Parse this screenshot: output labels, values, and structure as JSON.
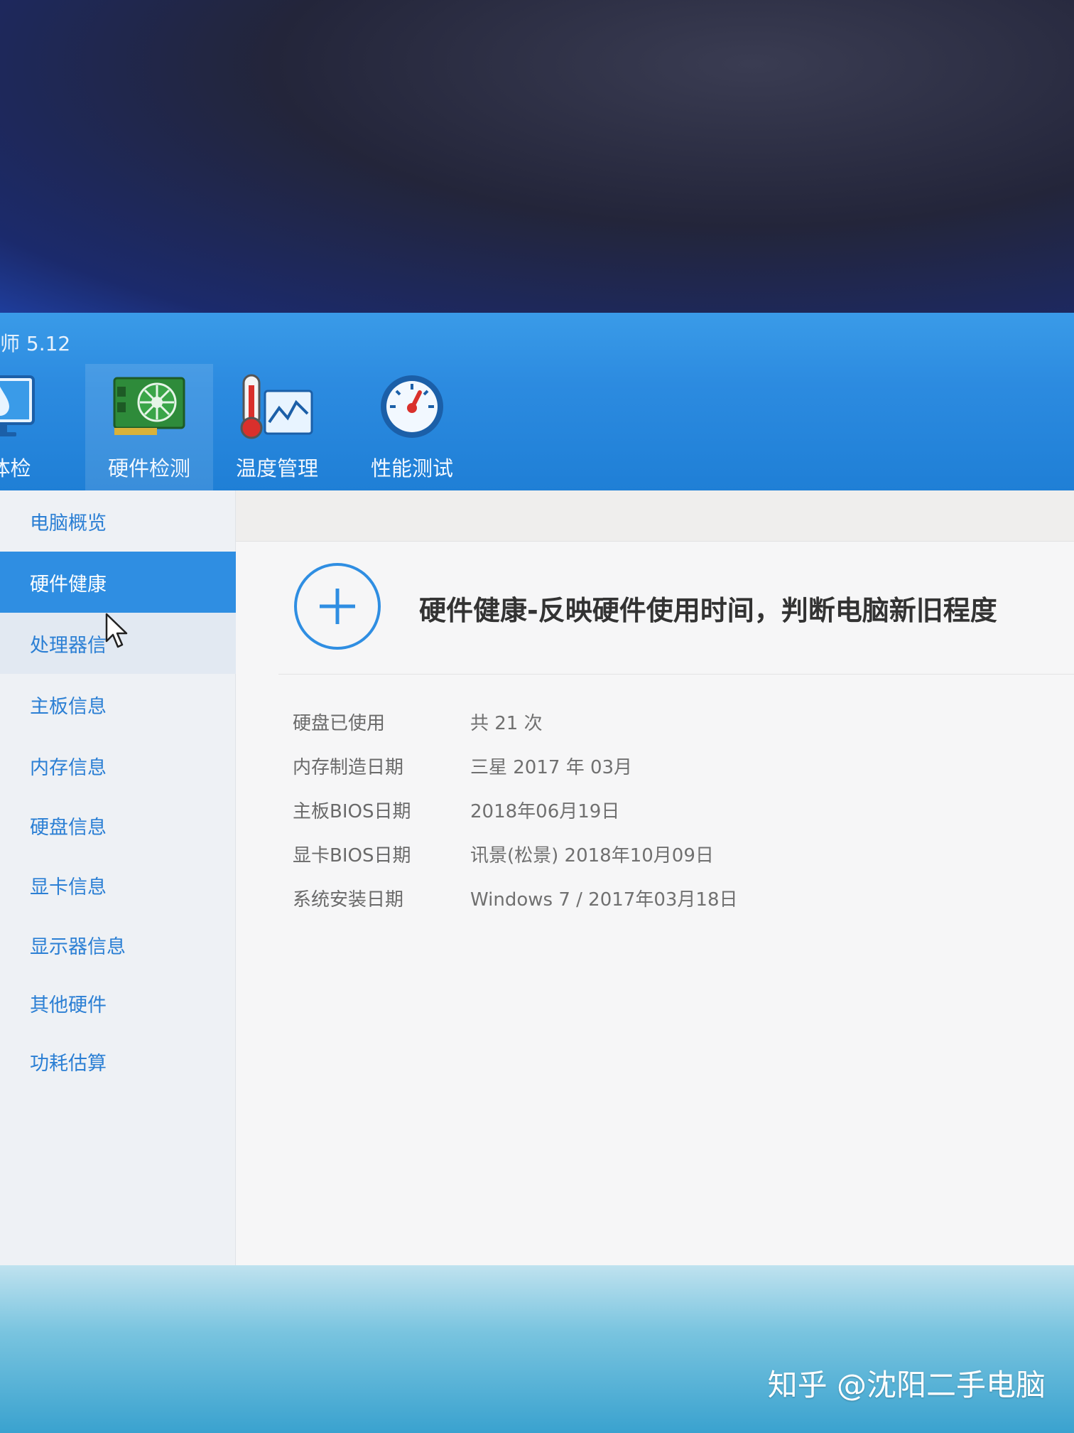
{
  "app": {
    "title": "师 5.12"
  },
  "tabs": [
    {
      "label": "件体检",
      "icon": "monitor-drop-icon"
    },
    {
      "label": "硬件检测",
      "icon": "hardware-card-icon"
    },
    {
      "label": "温度管理",
      "icon": "thermometer-chart-icon"
    },
    {
      "label": "性能测试",
      "icon": "speedometer-icon"
    }
  ],
  "sidebar": {
    "items": [
      {
        "label": "电脑概览"
      },
      {
        "label": "硬件健康"
      },
      {
        "label": "处理器信"
      },
      {
        "label": "主板信息"
      },
      {
        "label": "内存信息"
      },
      {
        "label": "硬盘信息"
      },
      {
        "label": "显卡信息"
      },
      {
        "label": "显示器信息"
      },
      {
        "label": "其他硬件"
      },
      {
        "label": "功耗估算"
      }
    ]
  },
  "content": {
    "headline": "硬件健康-反映硬件使用时间，判断电脑新旧程度",
    "rows": [
      {
        "label": "硬盘已使用",
        "value": "共 21 次"
      },
      {
        "label": "内存制造日期",
        "value": "三星 2017 年 03月"
      },
      {
        "label": "主板BIOS日期",
        "value": "2018年06月19日"
      },
      {
        "label": "显卡BIOS日期",
        "value": "讯景(松景) 2018年10月09日"
      },
      {
        "label": "系统安装日期",
        "value": "Windows 7 / 2017年03月18日"
      }
    ]
  },
  "watermark": "知乎 @沈阳二手电脑",
  "colors": {
    "header_blue": "#2c8be0",
    "active_item": "#2f8ee2",
    "link_blue": "#2b7fd4"
  }
}
